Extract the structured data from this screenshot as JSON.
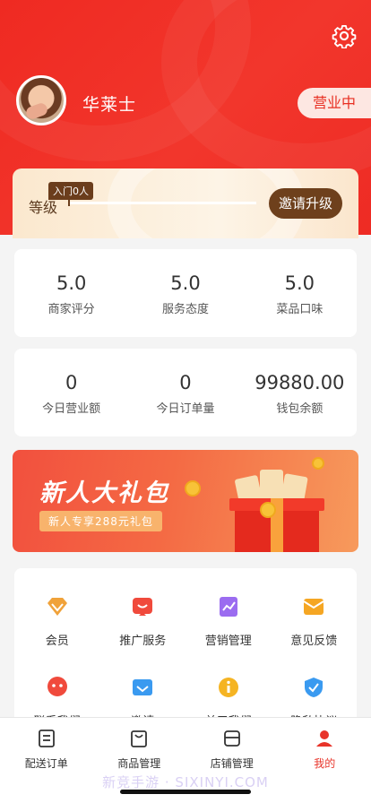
{
  "profile": {
    "name": "华莱士",
    "status": "营业中"
  },
  "level": {
    "label": "等级",
    "tag": "入门0人",
    "invite_label": "邀请升级"
  },
  "ratings": [
    {
      "value": "5.0",
      "label": "商家评分"
    },
    {
      "value": "5.0",
      "label": "服务态度"
    },
    {
      "value": "5.0",
      "label": "菜品口味"
    }
  ],
  "business": [
    {
      "value": "0",
      "label": "今日营业额"
    },
    {
      "value": "0",
      "label": "今日订单量"
    },
    {
      "value": "99880.00",
      "label": "钱包余额"
    }
  ],
  "banner": {
    "title": "新人大礼包",
    "subtitle": "新人专享288元礼包"
  },
  "services": [
    {
      "label": "会员",
      "icon": "diamond-icon",
      "color": "#f0a23a"
    },
    {
      "label": "推广服务",
      "icon": "promo-icon",
      "color": "#f04a3c"
    },
    {
      "label": "营销管理",
      "icon": "marketing-icon",
      "color": "#9b6cf0"
    },
    {
      "label": "意见反馈",
      "icon": "feedback-icon",
      "color": "#f5a623"
    },
    {
      "label": "联系我们",
      "icon": "contact-icon",
      "color": "#f04a3c"
    },
    {
      "label": "邀请",
      "icon": "invite-icon",
      "color": "#3a9af0"
    },
    {
      "label": "关于我们",
      "icon": "info-icon",
      "color": "#f5b423"
    },
    {
      "label": "隐私协议",
      "icon": "shield-icon",
      "color": "#3a9af0"
    }
  ],
  "tabs": [
    {
      "label": "配送订单",
      "icon": "orders-icon"
    },
    {
      "label": "商品管理",
      "icon": "bag-icon"
    },
    {
      "label": "店铺管理",
      "icon": "shop-icon"
    },
    {
      "label": "我的",
      "icon": "user-icon"
    }
  ],
  "watermark": "新竞手游 · SIXINYI.COM",
  "colors": {
    "header_red": "#ef2a22",
    "accent_brown": "#6e401c",
    "active_tab": "#e8342a"
  }
}
